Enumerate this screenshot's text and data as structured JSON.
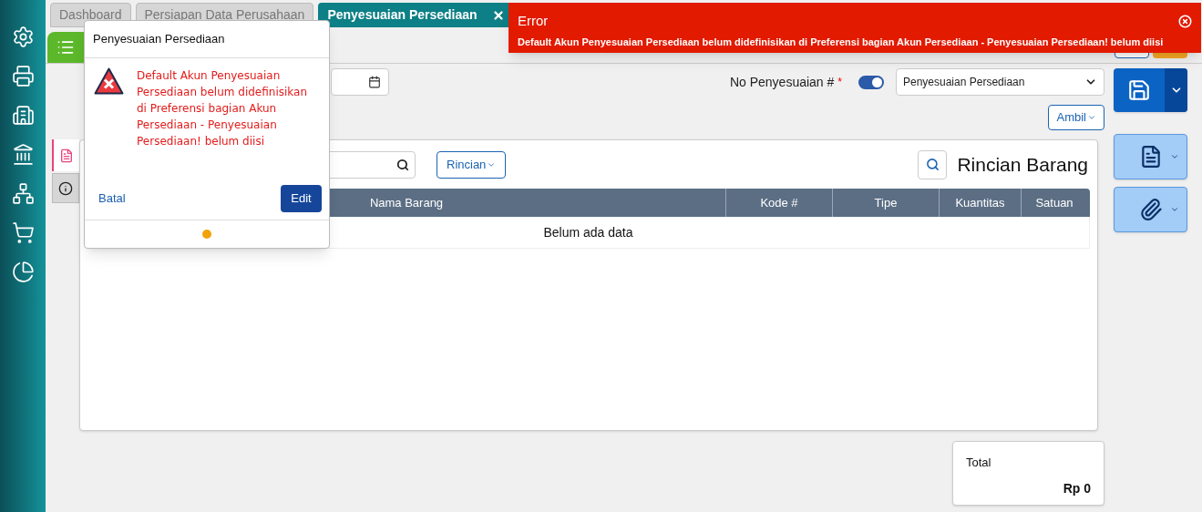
{
  "tabs": [
    {
      "label": "Dashboard",
      "selected": false
    },
    {
      "label": "Persiapan Data Perusahaan",
      "selected": false
    },
    {
      "label": "Penyesuaian Persediaan",
      "selected": true
    }
  ],
  "form": {
    "number_label": "No Penyesuaian #",
    "required_mark": "*",
    "auto_number": {
      "on": true
    },
    "type_select": {
      "value": "Penyesuaian Persediaan"
    },
    "ambil_button": "Ambil"
  },
  "detail": {
    "rincian_button": "Rincian",
    "title": "Rincian Barang",
    "columns": [
      "Nama Barang",
      "Kode #",
      "Tipe",
      "Kuantitas",
      "Satuan"
    ],
    "empty_text": "Belum ada data"
  },
  "total": {
    "label": "Total",
    "value": "Rp 0"
  },
  "popup": {
    "title": "Penyesuaian Persediaan",
    "message": "Default Akun Penyesuaian Persediaan belum didefinisikan di Preferensi bagian Akun Persediaan - Penyesuaian Persediaan! belum diisi",
    "cancel": "Batal",
    "edit": "Edit"
  },
  "toast": {
    "title": "Error",
    "message": "Default Akun Penyesuaian Persediaan belum didefinisikan di Preferensi bagian Akun Persediaan - Penyesuaian Persediaan! belum diisi"
  }
}
